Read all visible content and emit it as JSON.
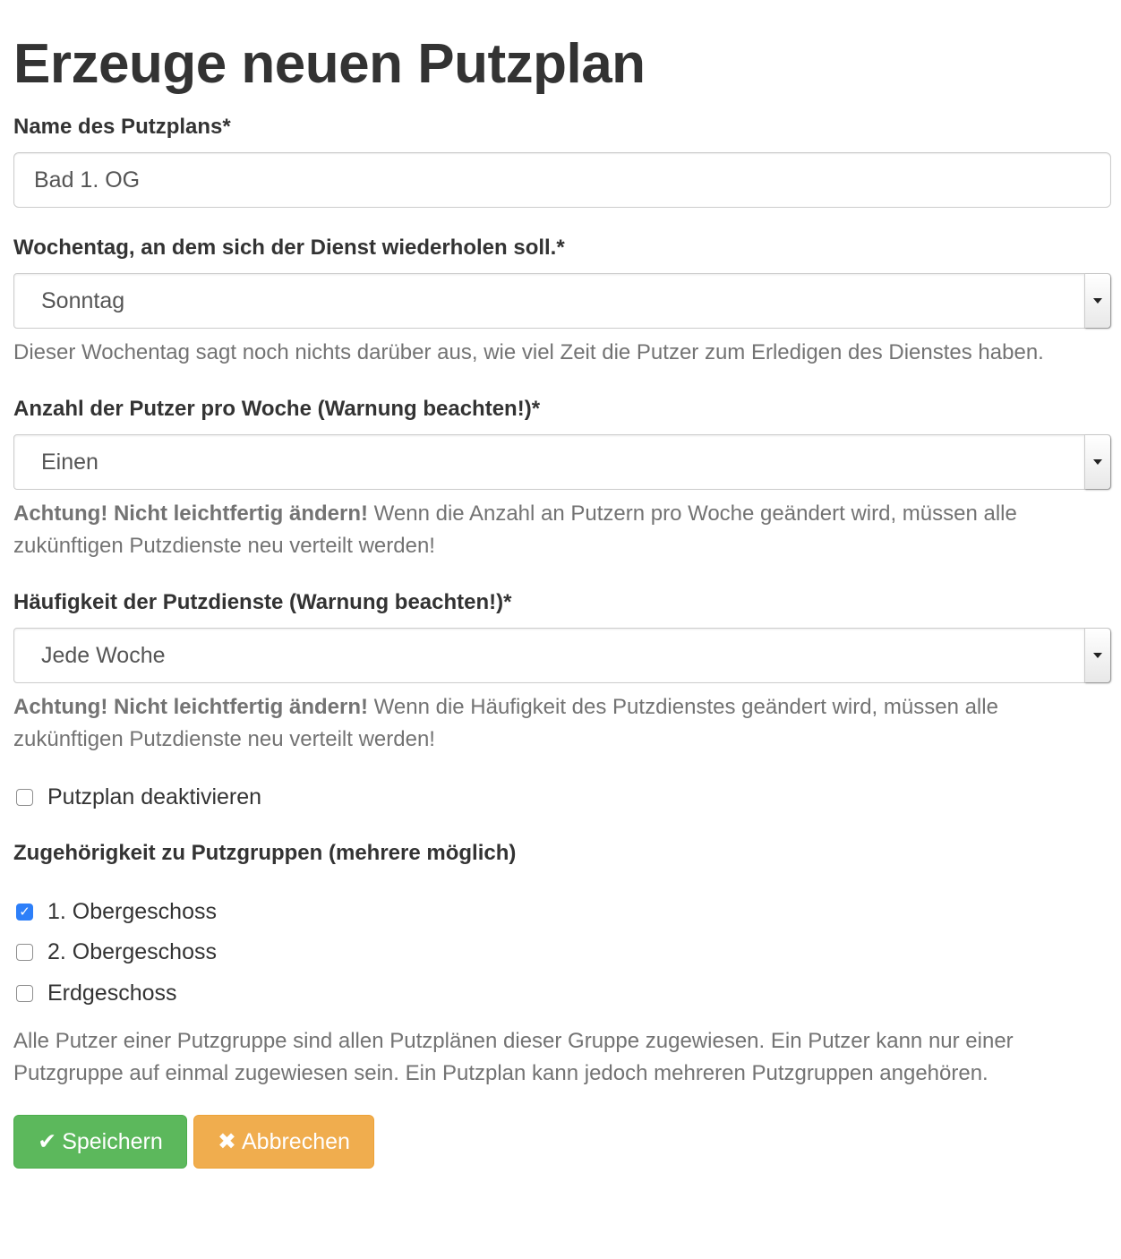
{
  "page_title": "Erzeuge neuen Putzplan",
  "name_field": {
    "label": "Name des Putzplans*",
    "value": "Bad 1. OG"
  },
  "weekday_field": {
    "label": "Wochentag, an dem sich der Dienst wiederholen soll.*",
    "value": "Sonntag",
    "help": "Dieser Wochentag sagt noch nichts darüber aus, wie viel Zeit die Putzer zum Erledigen des Dienstes haben."
  },
  "cleaners_field": {
    "label": "Anzahl der Putzer pro Woche (Warnung beachten!)*",
    "value": "Einen",
    "warning_bold": "Achtung! Nicht leichtfertig ändern!",
    "warning_text": " Wenn die Anzahl an Putzern pro Woche geändert wird, müssen alle zukünftigen Putzdienste neu verteilt werden!"
  },
  "frequency_field": {
    "label": "Häufigkeit der Putzdienste (Warnung beachten!)*",
    "value": "Jede Woche",
    "warning_bold": "Achtung! Nicht leichtfertig ändern!",
    "warning_text": " Wenn die Häufigkeit des Putzdienstes geändert wird, müssen alle zukünftigen Putzdienste neu verteilt werden!"
  },
  "deactivate_checkbox": {
    "label": "Putzplan deaktivieren",
    "checked": false
  },
  "groups": {
    "label": "Zugehörigkeit zu Putzgruppen (mehrere möglich)",
    "options": [
      {
        "label": "1. Obergeschoss",
        "checked": true
      },
      {
        "label": "2. Obergeschoss",
        "checked": false
      },
      {
        "label": "Erdgeschoss",
        "checked": false
      }
    ],
    "help": "Alle Putzer einer Putzgruppe sind allen Putzplänen dieser Gruppe zugewiesen. Ein Putzer kann nur einer Putzgruppe auf einmal zugewiesen sein. Ein Putzplan kann jedoch mehreren Putzgruppen angehören."
  },
  "buttons": {
    "save_label": "Speichern",
    "save_icon": "check-icon",
    "cancel_label": "Abbrechen",
    "cancel_icon": "times-icon"
  },
  "colors": {
    "save": "#5cb85c",
    "cancel": "#f0ad4e",
    "checkbox_checked": "#2d7ff9"
  }
}
